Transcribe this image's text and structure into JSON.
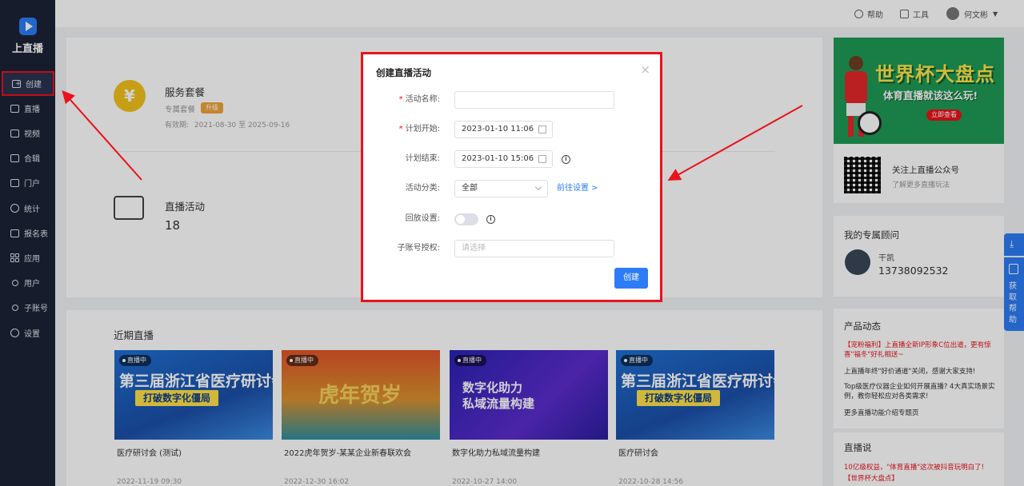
{
  "app": {
    "name": "上直播"
  },
  "sidebar": {
    "items": [
      {
        "label": "创建",
        "icon": "plus-square-icon",
        "active": true
      },
      {
        "label": "直播",
        "icon": "video-icon"
      },
      {
        "label": "视频",
        "icon": "film-icon"
      },
      {
        "label": "合辑",
        "icon": "album-icon"
      },
      {
        "label": "门户",
        "icon": "monitor-icon"
      },
      {
        "label": "统计",
        "icon": "pie-chart-icon"
      },
      {
        "label": "报名表",
        "icon": "form-icon"
      },
      {
        "label": "应用",
        "icon": "apps-grid-icon"
      },
      {
        "label": "用户",
        "icon": "users-icon"
      },
      {
        "label": "子账号",
        "icon": "sub-account-icon"
      },
      {
        "label": "设置",
        "icon": "gear-icon"
      }
    ]
  },
  "topbar": {
    "help": "帮助",
    "tools": "工具",
    "user": "何文彬"
  },
  "service": {
    "title": "服务套餐",
    "plan": "专属套餐",
    "upgrade": "升级",
    "validity_label": "有效期:",
    "validity": "2021-08-30 至 2025-09-16",
    "coin_symbol": "¥"
  },
  "live_activity": {
    "title": "直播活动",
    "count": "18"
  },
  "recent": {
    "title": "近期直播",
    "items": [
      {
        "badge": "直播中",
        "line1": "第三届浙江省医疗研讨会",
        "line2": "打破数字化僵局",
        "title": "医疗研讨会 (测试)",
        "date": "2022-11-19 09:30"
      },
      {
        "badge": "直播中",
        "line1": "虎年贺岁",
        "line2": "",
        "title": "2022虎年贺岁-某某企业新春联欢会",
        "date": "2022-12-30 16:02"
      },
      {
        "badge": "直播中",
        "line1": "数字化助力",
        "line2": "私域流量构建",
        "title": "数字化助力私域流量构建",
        "date": "2022-10-27 14:00"
      },
      {
        "badge": "直播中",
        "line1": "第三届浙江省医疗研讨会",
        "line2": "打破数字化僵局",
        "title": "医疗研讨会",
        "date": "2022-10-28 14:56"
      }
    ]
  },
  "modal": {
    "title": "创建直播活动",
    "fields": {
      "name_label": "活动名称:",
      "name_value": "",
      "start_label": "计划开始:",
      "start_value": "2023-01-10 11:06",
      "end_label": "计划结束:",
      "end_value": "2023-01-10 15:06",
      "category_label": "活动分类:",
      "category_value": "全部",
      "category_link": "前往设置 >",
      "replay_label": "回放设置:",
      "sub_label": "子账号授权:",
      "sub_placeholder": "请选择"
    },
    "submit": "创建"
  },
  "right": {
    "banner_title": "世界杯大盘点",
    "banner_sub": "体育直播就该这么玩!",
    "banner_btn": "立即查看",
    "qr_title": "关注上直播公众号",
    "qr_sub": "了解更多直播玩法",
    "advisor_title": "我的专属顾问",
    "advisor_name": "干凯",
    "advisor_phone": "13738092532",
    "news_title": "产品动态",
    "news": [
      "【宠粉福利】上直播全新IP形象C位出道，更有惊喜\"福冬\"好礼相送~",
      "上直播年终\"好价通道\"关闭，感谢大家支持!",
      "Top级医疗仪器企业如何开展直播? 4大真实场景实例，教你轻松应对各类需求!",
      "更多直播功能介绍专题页"
    ],
    "talk_title": "直播说",
    "talk": [
      "10亿级权益，\"体育直播\"这次被抖音玩明白了!",
      "【世界杯大盘点】"
    ]
  },
  "side_tool": {
    "label": "获取帮助"
  },
  "colors": {
    "accent": "#2c7cf6",
    "sidebar": "#1c2336",
    "highlight": "#e8131b"
  }
}
